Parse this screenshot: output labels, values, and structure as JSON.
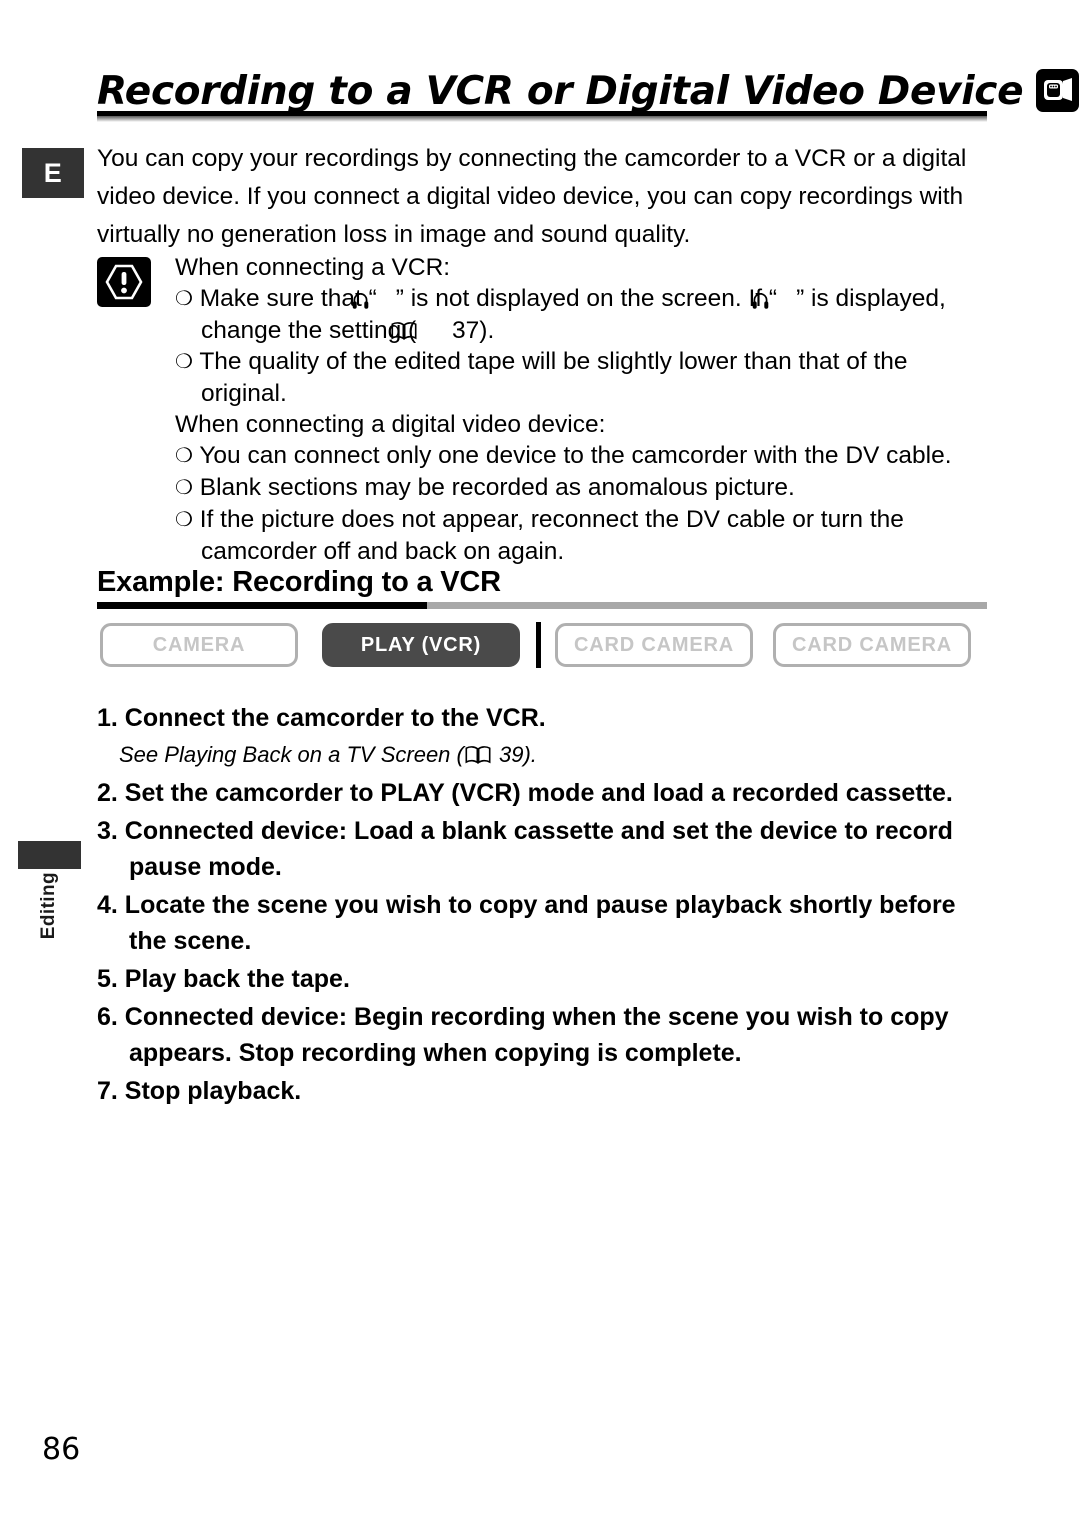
{
  "page": {
    "number": "86",
    "language_tab": "E",
    "section_tab": "Editing"
  },
  "header": {
    "title": "Recording to a VCR or Digital Video Device",
    "icons": [
      "camcorder-icon",
      "remote-control-icon"
    ]
  },
  "intro": {
    "paragraph": "You can copy your recordings by connecting the camcorder to a VCR or a digital video device. If you connect a digital video device, you can copy recordings with virtually no generation loss in image and sound quality."
  },
  "notice": {
    "icon": "warning-icon",
    "vcr_heading": "When connecting a VCR:",
    "vcr_bullet_1_part_1": "Make sure that “",
    "vcr_bullet_1_part_2": "” is not displayed on the screen. If “",
    "vcr_bullet_1_part_3": "” is displayed, change the setting (",
    "vcr_bullet_1_page": "37",
    "vcr_bullet_1_end": ").",
    "vcr_bullet_2": "The quality of the edited tape will be slightly lower than that of the original.",
    "dv_heading": "When connecting a digital video device:",
    "dv_bullet_1": "You can connect only one device to the camcorder with the DV cable.",
    "dv_bullet_2": "Blank sections may be recorded as anomalous picture.",
    "dv_bullet_3": "If the picture does not appear, reconnect the DV cable or turn the camcorder off and back on again."
  },
  "example": {
    "heading": "Example: Recording to a VCR",
    "modes": [
      {
        "label": "CAMERA",
        "active": false
      },
      {
        "label": "PLAY (VCR)",
        "active": true
      },
      {
        "label": "CARD CAMERA",
        "active": false
      },
      {
        "label": "CARD CAMERA",
        "active": false
      }
    ]
  },
  "steps": {
    "step1": "1. Connect the camcorder to the VCR.",
    "step1_note_prefix": "See ",
    "step1_note_italic": "Playing Back on a TV Screen",
    "step1_note_mid": " (",
    "step1_note_page": "39",
    "step1_note_end": ").",
    "step2": "2. Set the camcorder to PLAY (VCR) mode and load a recorded cassette.",
    "step3": "3. Connected device: Load a blank cassette and set the device to record pause mode.",
    "step4": "4. Locate the scene you wish to copy and pause playback shortly before the scene.",
    "step5": "5. Play back the tape.",
    "step6": "6. Connected device: Begin recording when the scene you wish to copy appears. Stop recording when copying is complete.",
    "step7": "7. Stop playback."
  },
  "colors": {
    "tab_dark": "#333333",
    "mode_active_bg": "#4a4a4a",
    "mode_off_border": "#b0b0b0",
    "mode_off_text": "#c6c6c6",
    "rule_gray": "#a8a8a8"
  }
}
